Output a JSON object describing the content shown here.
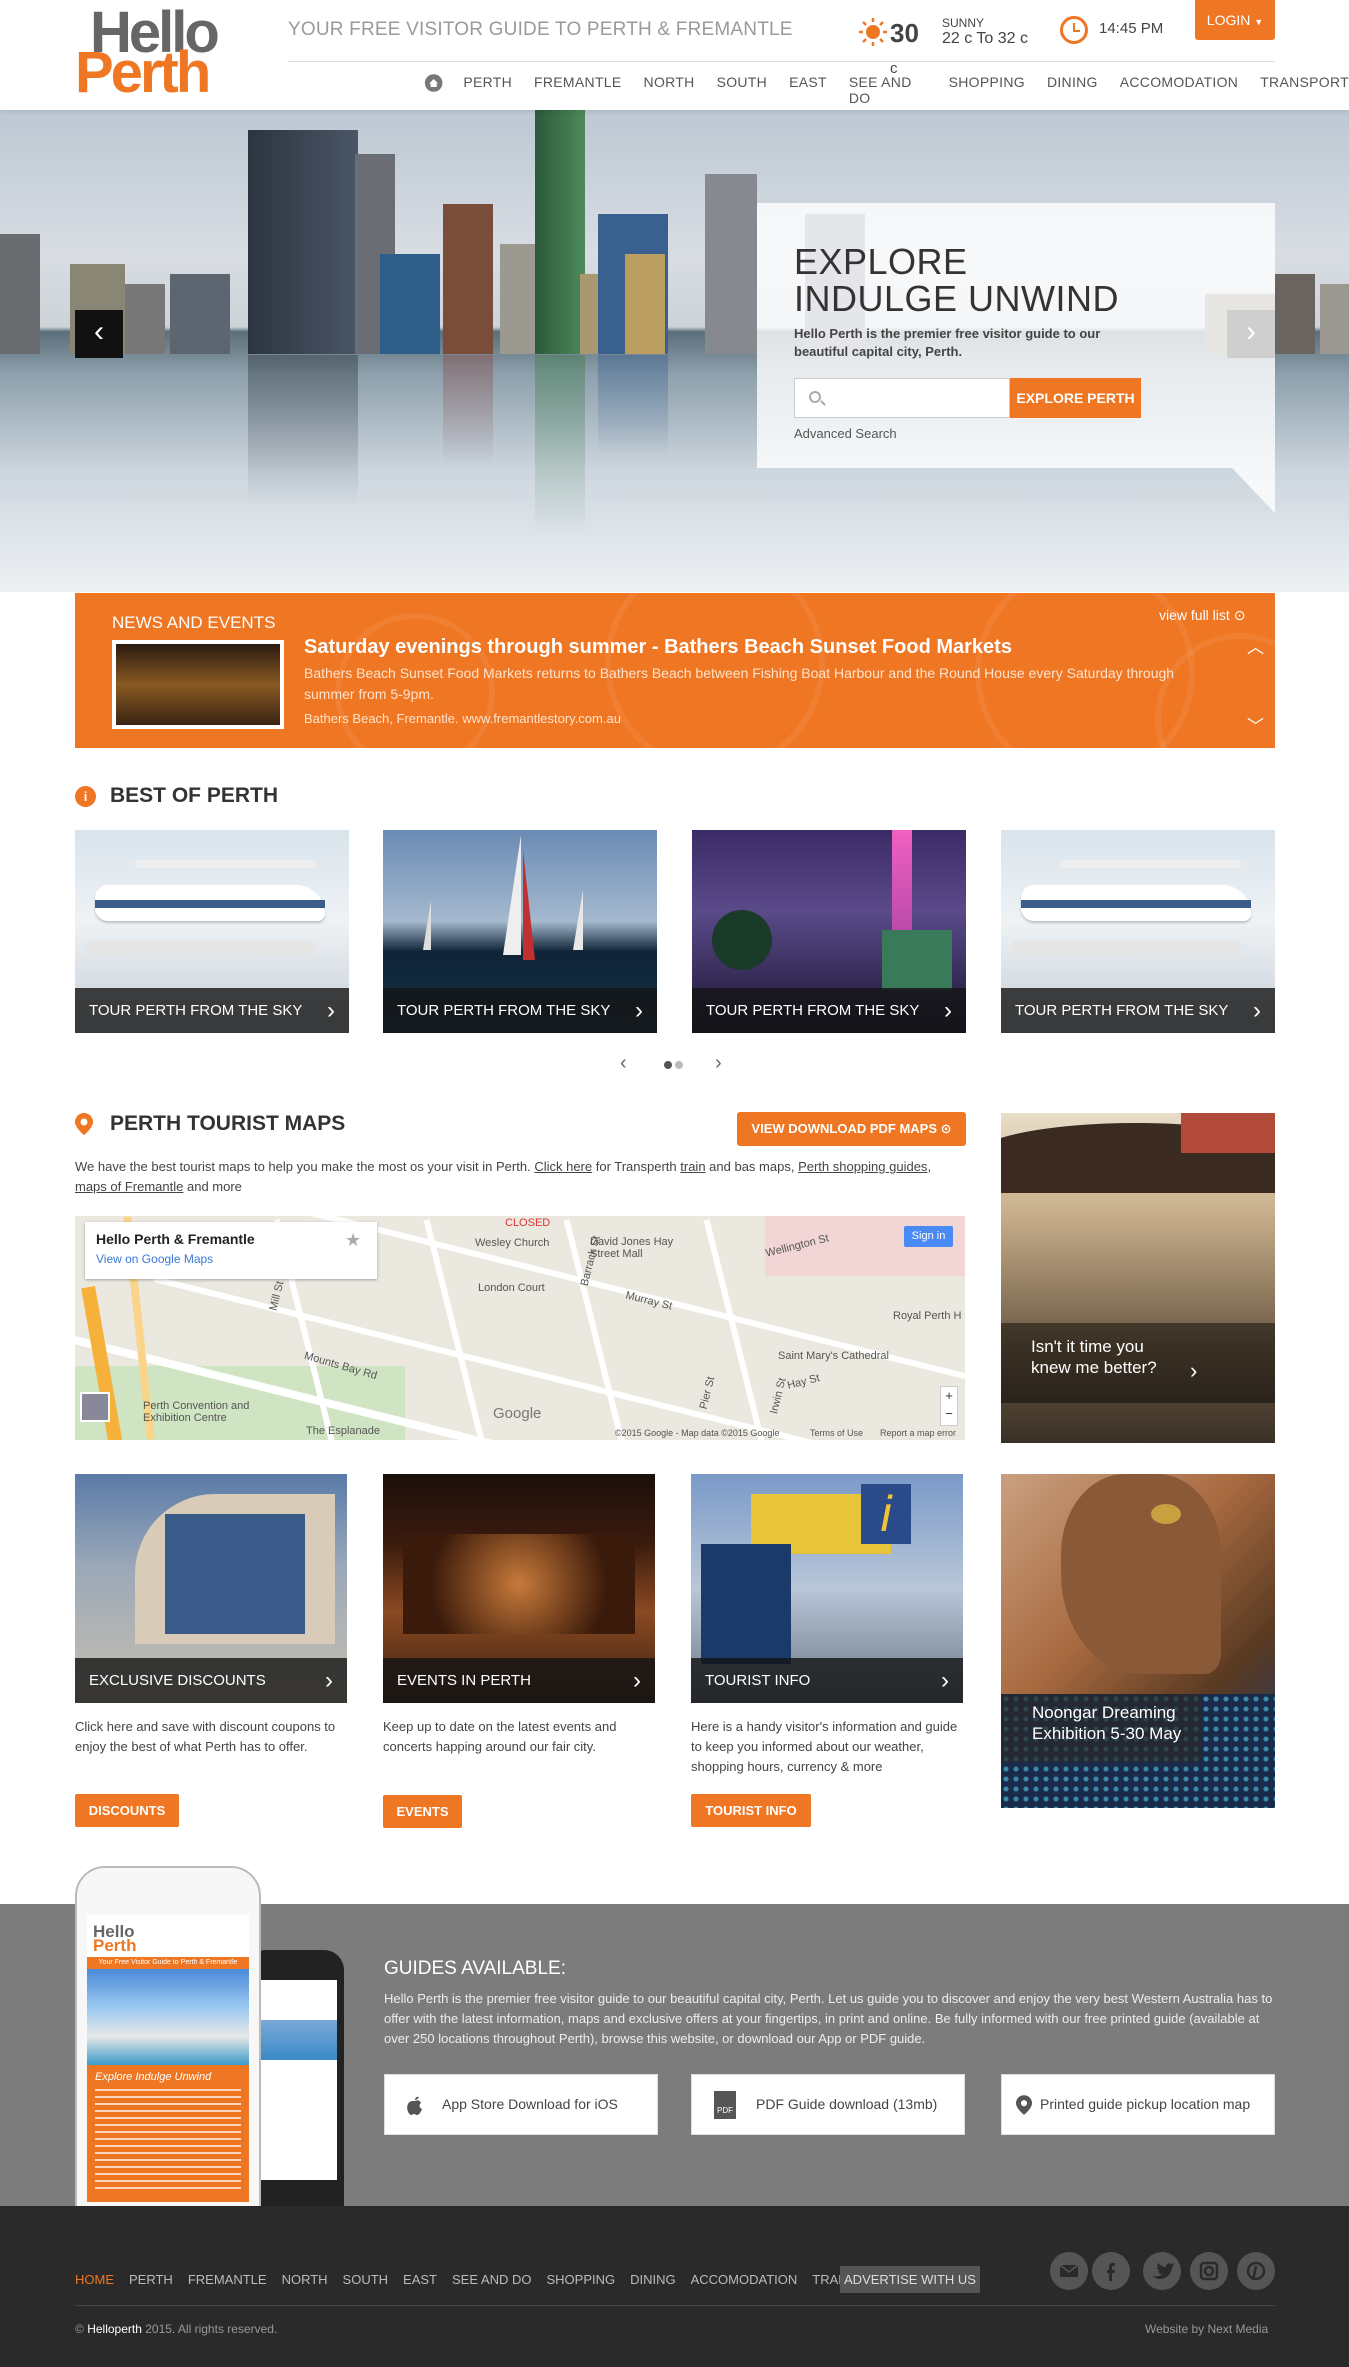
{
  "header": {
    "logo_top": "Hello",
    "logo_bottom": "Perth",
    "tagline": "YOUR FREE VISITOR GUIDE TO PERTH & FREMANTLE",
    "temp": "30",
    "temp_unit": "c",
    "condition": "SUNNY",
    "range": "22 c To 32 c",
    "time": "14:45 PM",
    "login": "LOGIN",
    "nav": [
      "PERTH",
      "FREMANTLE",
      "NORTH",
      "SOUTH",
      "EAST",
      "SEE AND DO",
      "SHOPPING",
      "DINING",
      "ACCOMODATION",
      "TRANSPORT"
    ]
  },
  "hero": {
    "line1": "EXPLORE",
    "line2": "INDULGE UNWIND",
    "description": "Hello Perth is the premier free visitor guide to our beautiful capital city, Perth.",
    "search_placeholder": "",
    "search_button": "EXPLORE PERTH",
    "advanced": "Advanced Search",
    "prev": "‹",
    "next": "›"
  },
  "news": {
    "heading": "NEWS AND EVENTS",
    "title": "Saturday evenings through summer - Bathers Beach Sunset Food Markets",
    "description": "Bathers Beach Sunset Food Markets returns to Bathers Beach between Fishing Boat Harbour and the Round House every Saturday through summer from 5-9pm.",
    "location": "Bathers Beach, Fremantle. www.fremantlestory.com.au",
    "view_full": "view full list"
  },
  "best": {
    "title": "BEST OF PERTH",
    "cards": [
      "TOUR PERTH FROM THE SKY",
      "TOUR PERTH FROM THE SKY",
      "TOUR PERTH FROM THE SKY",
      "TOUR PERTH FROM THE SKY"
    ]
  },
  "maps": {
    "title": "PERTH TOURIST MAPS",
    "button": "VIEW DOWNLOAD PDF MAPS",
    "desc_1": "We have the best tourist maps to help you make the most os your visit in Perth. ",
    "click_here": "Click here",
    "desc_2": " for Transperth ",
    "train": "train",
    "desc_3": " and bas maps, ",
    "shopping": "Perth shopping guides",
    "desc_4": ", ",
    "fremantle": "maps of Fremantle",
    "desc_5": " and more",
    "map_title": "Hello Perth & Fremantle",
    "map_link": "View on Google Maps",
    "sign_in": "Sign in",
    "labels": [
      "Wesley Church",
      "David Jones Hay Street Mall",
      "London Court",
      "Wellington St",
      "Royal Perth H",
      "Mounts Bay Rd",
      "Saint Mary's Cathedral",
      "Hay St",
      "Perth Convention and Exhibition Centre",
      "The Esplanade",
      "CLOSED",
      "Google",
      "©2015 Google - Map data ©2015 Google",
      "Terms of Use",
      "Report a map error",
      "Mill St",
      "Pier St",
      "Irwin St",
      "Barrack St",
      "Murray St"
    ],
    "side_caption": "Isn't it time you knew me better?"
  },
  "features": [
    {
      "label": "EXCLUSIVE DISCOUNTS",
      "desc": "Click here and save with discount coupons to enjoy the best of what Perth has to offer.",
      "button": "DISCOUNTS"
    },
    {
      "label": "EVENTS IN PERTH",
      "desc": "Keep up to date on the latest events and concerts happing around our fair city.",
      "button": "EVENTS"
    },
    {
      "label": "TOURIST INFO",
      "desc": "Here is a handy visitor's information and guide to keep you informed about our weather, shopping hours, currency & more",
      "button": "TOURIST INFO"
    }
  ],
  "promo": {
    "caption": "Noongar Dreaming Exhibition 5-30 May"
  },
  "guides": {
    "title": "GUIDES AVAILABLE:",
    "description": "Hello Perth is the premier free visitor guide to our beautiful capital city, Perth. Let us guide you to discover and enjoy the very best Western Australia has to offer with the latest information, maps and exclusive offers at your fingertips, in print and online. Be fully informed with our free printed guide (available at over 250 locations throughout Perth), browse this website, or download our App or PDF guide.",
    "buttons": [
      "App Store Download for iOS",
      "PDF Guide download (13mb)",
      "Printed guide pickup location map"
    ],
    "phone_tagline": "Your Free Visitor Guide to Perth & Fremantle",
    "phone_heading": "Explore Indulge Unwind",
    "pdf_badge": "PDF"
  },
  "footer": {
    "nav": [
      "HOME",
      "PERTH",
      "FREMANTLE",
      "NORTH",
      "SOUTH",
      "EAST",
      "SEE AND DO",
      "SHOPPING",
      "DINING",
      "ACCOMODATION",
      "TRANSPORT"
    ],
    "advertise": "ADVERTISE WITH US",
    "copyright_prefix": "© ",
    "brand": "Helloperth",
    "copyright_suffix": " 2015. All rights reserved.",
    "credit": "Website by Next Media"
  },
  "colors": {
    "accent": "#ef7622",
    "footer": "#2a2a2a",
    "guides": "#7c7c7c"
  }
}
